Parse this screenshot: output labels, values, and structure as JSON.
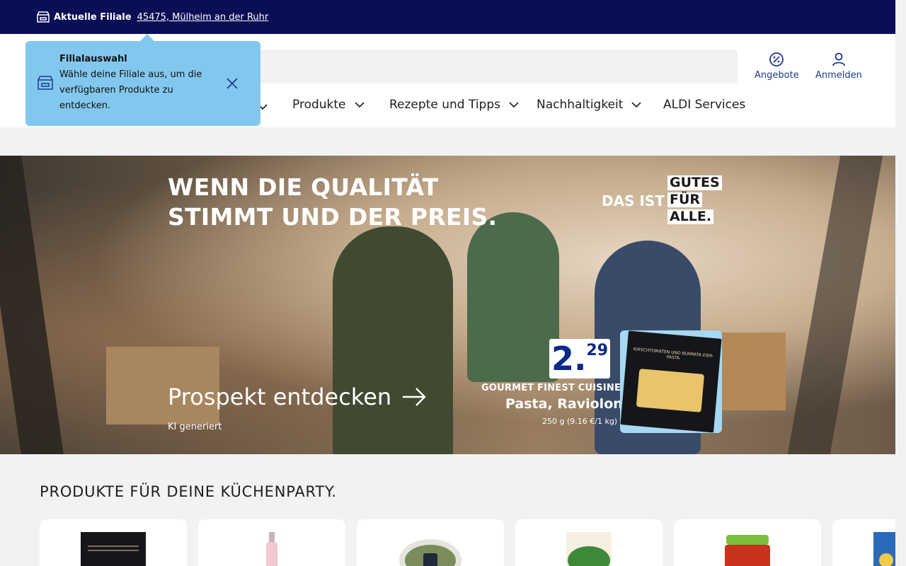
{
  "store_bar": {
    "label": "Aktuelle Filiale",
    "location": "45475, Mülheim an der Ruhr"
  },
  "header": {
    "search_placeholder": "",
    "actions": [
      {
        "label": "Angebote",
        "icon": "percent-badge-icon"
      },
      {
        "label": "Anmelden",
        "icon": "user-icon"
      }
    ],
    "nav": [
      {
        "label": "Produkte",
        "has_dropdown": true
      },
      {
        "label": "Rezepte und Tipps",
        "has_dropdown": true
      },
      {
        "label": "Nachhaltigkeit",
        "has_dropdown": true
      },
      {
        "label": "ALDI Services",
        "has_dropdown": false
      }
    ]
  },
  "popover": {
    "title": "Filialauswahl",
    "text": "Wähle deine Filiale aus, um die verfügbaren Produkte zu entdecken.",
    "icon": "store-icon"
  },
  "hero": {
    "headline_1": "WENN DIE QUALITÄT",
    "headline_2": "STIMMT UND DER PREIS.",
    "slogan_pre": "DAS IST",
    "slogan_1": "GUTES",
    "slogan_2": "FÜR",
    "slogan_3": "ALLE.",
    "cta": "Prospekt entdecken",
    "ai_note": "KI generiert",
    "price_int": "2.",
    "price_dec": "29",
    "brand": "GOURMET FINEST CUISINE",
    "product_name": "Pasta, Ravioloni",
    "product_weight": "250 g (9.16 €/1 kg)",
    "pack_text": "KIRSCHTOMATEN UND BURRATA EIER-PASTA"
  },
  "section": {
    "title": "PRODUKTE FÜR DEINE KÜCHENPARTY."
  },
  "products": [
    {
      "name": "pasta-pack",
      "color": "#15161a"
    },
    {
      "name": "rose-bottle",
      "color": "#f2c9d3"
    },
    {
      "name": "pesto-tub",
      "color": "#7a8c5a"
    },
    {
      "name": "crunchy-snack",
      "color": "#3f8a3a"
    },
    {
      "name": "tomato-jar",
      "color": "#c9331e"
    },
    {
      "name": "blue-pack",
      "color": "#2a6ab8"
    }
  ],
  "colors": {
    "store_bar_bg": "#0a0e55",
    "accent_blue": "#1c3a8c",
    "popover_bg": "#82c8ee"
  }
}
